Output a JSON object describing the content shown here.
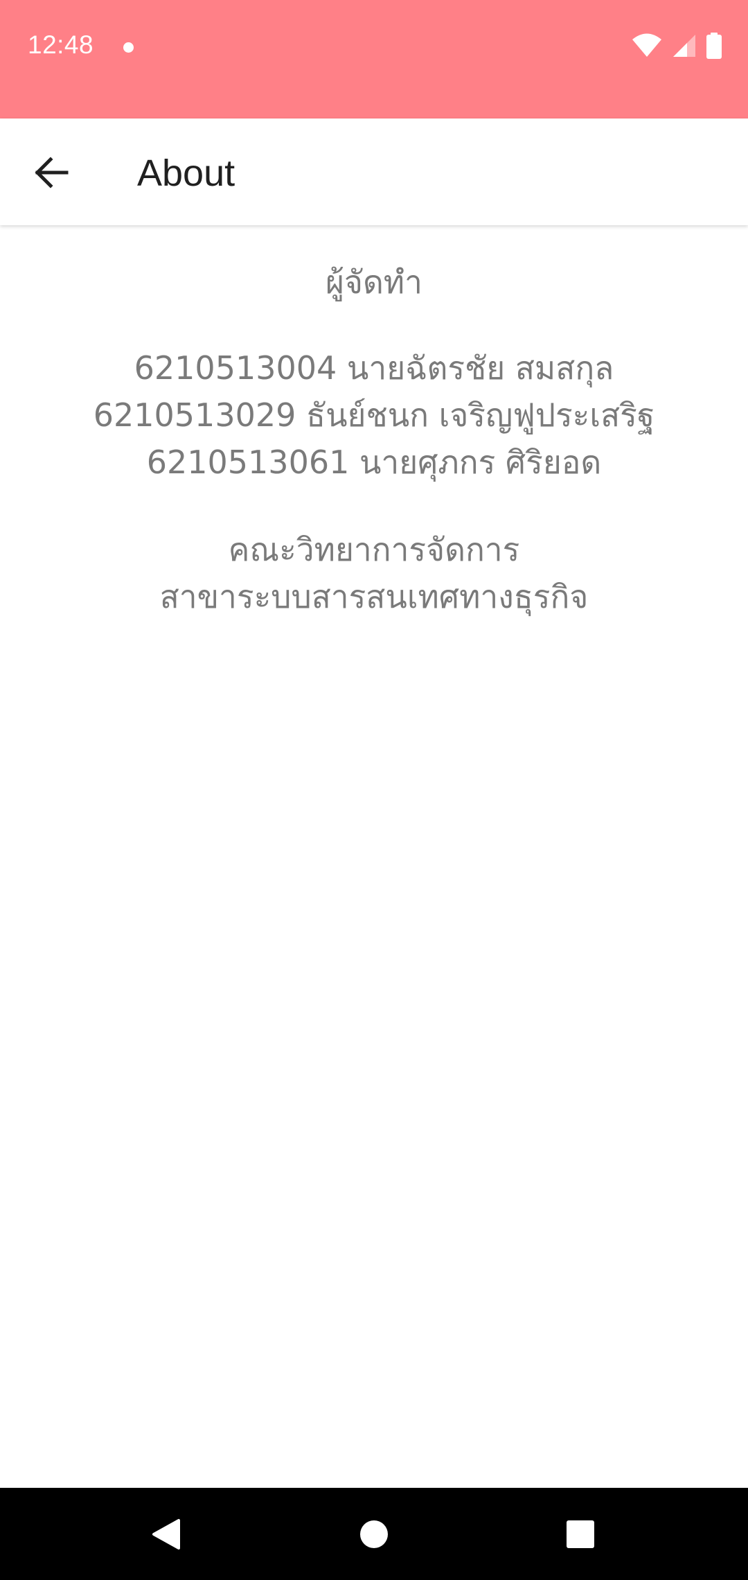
{
  "status_bar": {
    "time": "12:48",
    "icons": [
      "notification-dot-icon",
      "wifi-icon",
      "signal-icon",
      "battery-icon"
    ],
    "background": "#ff8087"
  },
  "app_bar": {
    "back_icon": "arrow-back-icon",
    "title": "About"
  },
  "content": {
    "heading": "ผู้จัดทำ",
    "members": [
      "6210513004 นายฉัตรชัย สมสกุล",
      "6210513029 ธันย์ชนก เจริญฟูประเสริฐ",
      "6210513061 นายศุภกร ศิริยอด"
    ],
    "department": [
      "คณะวิทยาการจัดการ",
      "สาขาระบบสารสนเทศทางธุรกิจ"
    ],
    "text_color": "#7a7a7a"
  },
  "nav_bar": {
    "buttons": [
      "back-triangle-icon",
      "home-circle-icon",
      "recents-square-icon"
    ]
  }
}
